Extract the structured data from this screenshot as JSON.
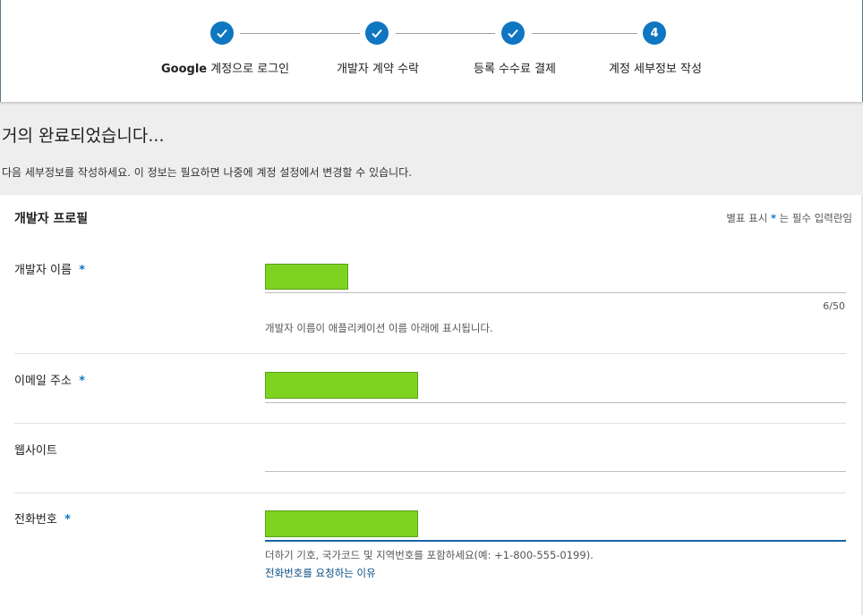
{
  "stepper": {
    "steps": [
      {
        "label_bold": "Google",
        "label": " 계정으로 로그인",
        "state": "done"
      },
      {
        "label_bold": "",
        "label": "개발자 계약 수락",
        "state": "done"
      },
      {
        "label_bold": "",
        "label": "등록 수수료 결제",
        "state": "done"
      },
      {
        "label_bold": "",
        "label": "계정 세부정보 작성",
        "state": "current",
        "number": "4"
      }
    ]
  },
  "page": {
    "title": "거의 완료되었습니다...",
    "description": "다음 세부정보를 작성하세요. 이 정보는 필요하면 나중에 계정 설정에서 변경할 수 있습니다."
  },
  "form": {
    "title": "개발자 프로필",
    "required_note_prefix": "별표 표시",
    "required_star": "*",
    "required_note_suffix": "는 필수 입력란임",
    "fields": {
      "developer_name": {
        "label": "개발자 이름",
        "star": "*",
        "counter": "6/50",
        "hint": "개발자 이름이 애플리케이션 이름 아래에 표시됩니다."
      },
      "email": {
        "label": "이메일 주소",
        "star": "*"
      },
      "website": {
        "label": "웹사이트"
      },
      "phone": {
        "label": "전화번호",
        "star": "*",
        "hint": "더하기 기호, 국가코드 및 지역번호를 포함하세요(예: +1-800-555-0199).",
        "link": "전화번호를 요청하는 이유"
      }
    }
  },
  "colors": {
    "accent": "#0f76c1",
    "redaction": "#7ed321",
    "link": "#0d4f86"
  }
}
